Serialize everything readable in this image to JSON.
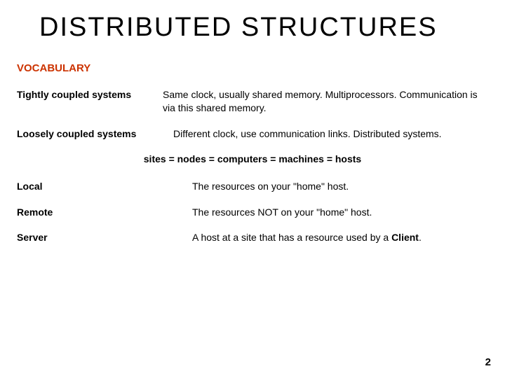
{
  "title": "DISTRIBUTED  STRUCTURES",
  "section_heading": "VOCABULARY",
  "row1_term": "Tightly coupled systems",
  "row1_def": "Same clock, usually shared memory. Multiprocessors. Communication is via this shared memory.",
  "row2_term": "Loosely coupled systems",
  "row2_def": "Different clock, use communication links. Distributed systems.",
  "equiv_line": "sites = nodes = computers = machines = hosts",
  "local_term": "Local",
  "local_def": "The  resources on your \"home\" host.",
  "remote_term": "Remote",
  "remote_def": "The  resources NOT on your \"home\" host.",
  "server_term": "Server",
  "server_def_pre": "A host at a site that has a resource used by a ",
  "server_def_bold": "Client",
  "server_def_post": ".",
  "page_number": "2"
}
